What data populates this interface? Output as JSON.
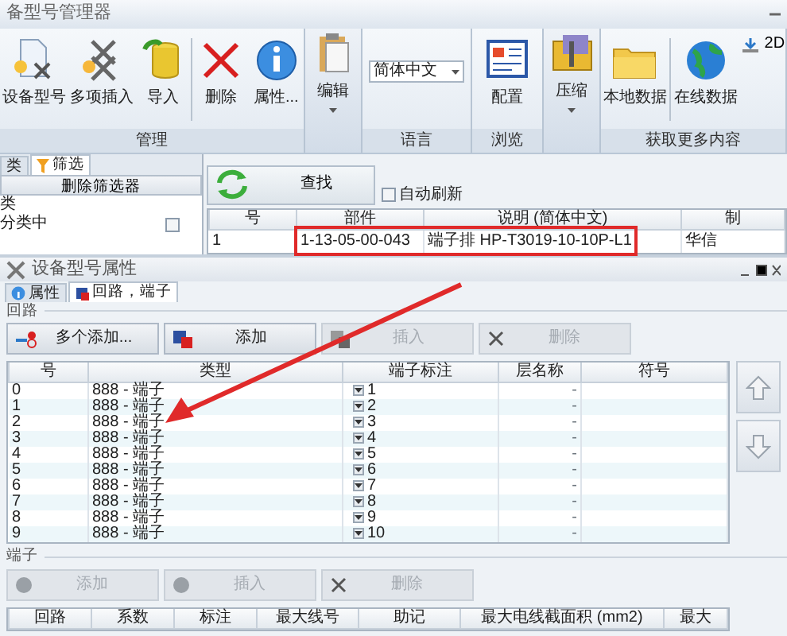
{
  "window": {
    "title": "备型号管理器"
  },
  "ribbon": {
    "groups": [
      {
        "label": "管理",
        "items": [
          {
            "kind": "large",
            "label": "设备型号"
          },
          {
            "kind": "large",
            "label": "多项插入"
          },
          {
            "kind": "large",
            "label": "导入"
          },
          {
            "kind": "separator"
          },
          {
            "kind": "large",
            "label": "删除"
          },
          {
            "kind": "large",
            "label": "属性..."
          }
        ]
      },
      {
        "items": [
          {
            "kind": "dropdown",
            "label": "编辑"
          }
        ]
      },
      {
        "label": "语言",
        "items": [
          {
            "kind": "select",
            "value": "简体中文"
          }
        ]
      },
      {
        "label": "浏览",
        "items": [
          {
            "kind": "large",
            "label": "配置"
          }
        ]
      },
      {
        "items": [
          {
            "kind": "dropdown",
            "label": "压缩"
          }
        ]
      },
      {
        "label": "获取更多内容",
        "items": [
          {
            "kind": "large",
            "label": "本地数据"
          },
          {
            "kind": "separator"
          },
          {
            "kind": "large",
            "label": "在线数据"
          },
          {
            "kind": "small",
            "label": "2D"
          }
        ]
      }
    ]
  },
  "filter_panel": {
    "tabs": [
      {
        "label": "类",
        "selected": false
      },
      {
        "label": "筛选",
        "selected": true
      }
    ],
    "button": "删除筛选器",
    "items": [
      {
        "label": "类"
      },
      {
        "label": "分类中",
        "checked": false
      }
    ]
  },
  "search": {
    "button": "查找",
    "auto_refresh": {
      "label": "自动刷新",
      "checked": false
    }
  },
  "results": {
    "columns": [
      "号",
      "部件",
      "说明 (简体中文)",
      "制"
    ],
    "rows": [
      [
        "1",
        "1-13-05-00-043",
        "端子排 HP-T3019-10-10P-L1",
        "华信"
      ]
    ]
  },
  "properties_window": {
    "title": "设备型号属性",
    "tabs": [
      {
        "label": "属性",
        "selected": false
      },
      {
        "label": "回路，端子",
        "selected": true
      }
    ],
    "circuits": {
      "legend": "回路",
      "buttons": [
        {
          "label": "多个添加...",
          "disabled": false
        },
        {
          "label": "添加",
          "disabled": false
        },
        {
          "label": "插入",
          "disabled": true
        },
        {
          "label": "删除",
          "disabled": true
        }
      ],
      "columns": [
        "号",
        "类型",
        "端子标注",
        "层名称",
        "符号"
      ],
      "rows": [
        {
          "number": "0",
          "type": "888 - 端子",
          "terminal": "1",
          "layer": "-"
        },
        {
          "number": "1",
          "type": "888 - 端子",
          "terminal": "2",
          "layer": "-"
        },
        {
          "number": "2",
          "type": "888 - 端子",
          "terminal": "3",
          "layer": "-"
        },
        {
          "number": "3",
          "type": "888 - 端子",
          "terminal": "4",
          "layer": "-"
        },
        {
          "number": "4",
          "type": "888 - 端子",
          "terminal": "5",
          "layer": "-"
        },
        {
          "number": "5",
          "type": "888 - 端子",
          "terminal": "6",
          "layer": "-"
        },
        {
          "number": "6",
          "type": "888 - 端子",
          "terminal": "7",
          "layer": "-"
        },
        {
          "number": "7",
          "type": "888 - 端子",
          "terminal": "8",
          "layer": "-"
        },
        {
          "number": "8",
          "type": "888 - 端子",
          "terminal": "9",
          "layer": "-"
        },
        {
          "number": "9",
          "type": "888 - 端子",
          "terminal": "10",
          "layer": "-"
        }
      ]
    },
    "terminals": {
      "legend": "端子",
      "buttons": [
        {
          "label": "添加",
          "disabled": true
        },
        {
          "label": "插入",
          "disabled": true
        },
        {
          "label": "删除",
          "disabled": true
        }
      ],
      "columns": [
        "回路",
        "系数",
        "标注",
        "最大线号",
        "助记",
        "最大电线截面积 (mm2)",
        "最大"
      ]
    }
  }
}
